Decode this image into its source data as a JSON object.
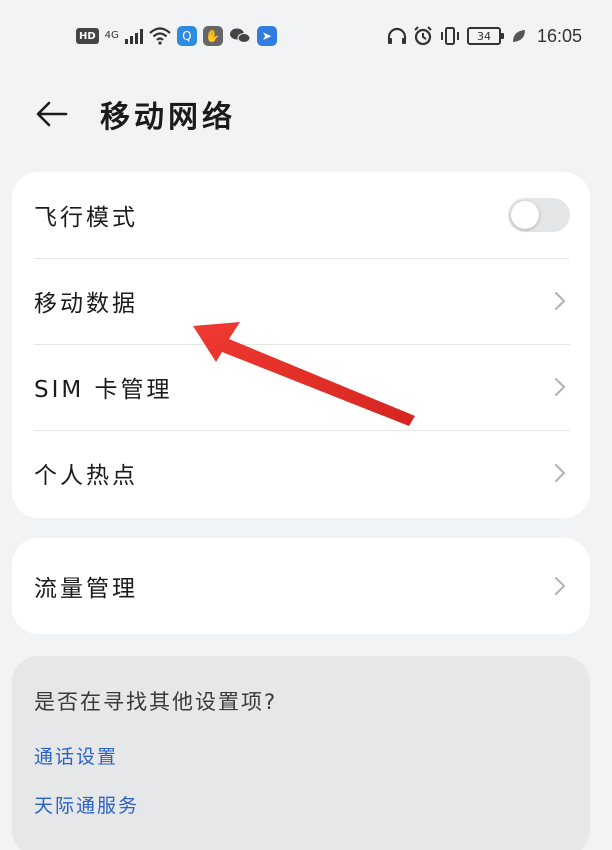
{
  "status_bar": {
    "left_badge": "HD",
    "network": "4G",
    "time": "16:05",
    "battery": "34"
  },
  "header": {
    "title": "移动网络"
  },
  "main_list": {
    "items": [
      {
        "label": "飞行模式",
        "control": "toggle",
        "toggle_on": false
      },
      {
        "label": "移动数据",
        "control": "chevron"
      },
      {
        "label": "SIM 卡管理",
        "control": "chevron"
      },
      {
        "label": "个人热点",
        "control": "chevron"
      }
    ]
  },
  "traffic": {
    "label": "流量管理"
  },
  "suggestions": {
    "title": "是否在寻找其他设置项?",
    "links": [
      "通话设置",
      "天际通服务"
    ]
  },
  "colors": {
    "background": "#f1f3f5",
    "card": "#ffffff",
    "link": "#2b63c7",
    "annotation_arrow": "#e8322c"
  },
  "icons": {
    "back": "back-arrow-icon",
    "chevron": "chevron-right-icon"
  }
}
